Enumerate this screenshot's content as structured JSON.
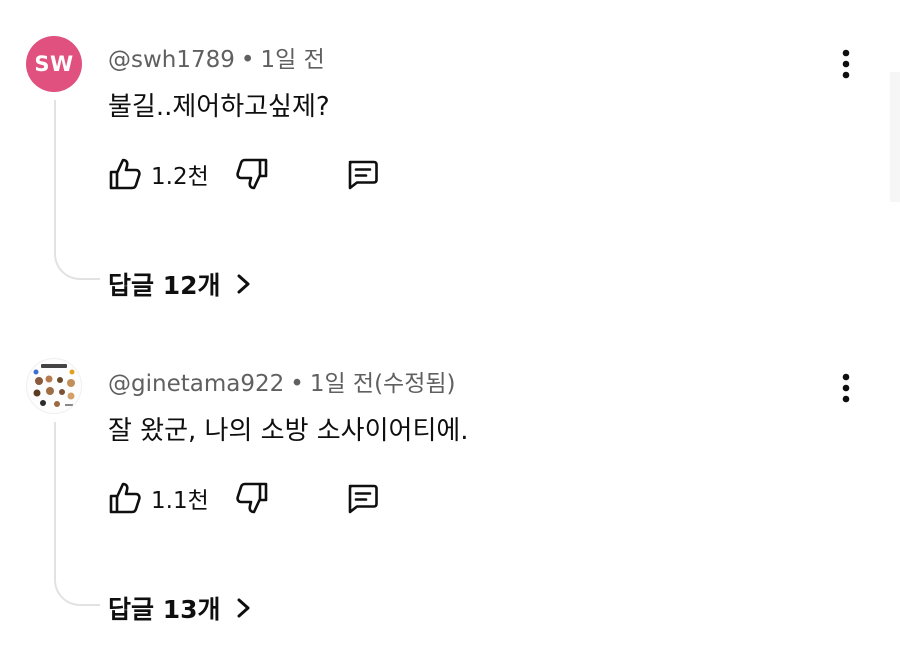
{
  "comments": [
    {
      "avatar_initials": "SW",
      "author": "@swh1789",
      "separator": "•",
      "time": "1일 전",
      "text": "불길..제어하고싶제?",
      "likes": "1.2천",
      "replies_label": "답글 12개",
      "icons": {
        "like": "thumbs-up-icon",
        "dislike": "thumbs-down-icon",
        "reply": "comment-icon",
        "menu": "more-vert-icon",
        "expand": "chevron-right-icon"
      },
      "colors": {
        "avatar_bg": "#e0517f"
      }
    },
    {
      "avatar_image": "avatar-image",
      "author": "@ginetama922",
      "separator": "•",
      "time": "1일 전(수정됨)",
      "text": "잘 왔군, 나의 소방 소사이어티에.",
      "likes": "1.1천",
      "replies_label": "답글 13개",
      "icons": {
        "like": "thumbs-up-icon",
        "dislike": "thumbs-down-icon",
        "reply": "comment-icon",
        "menu": "more-vert-icon",
        "expand": "chevron-right-icon"
      }
    }
  ]
}
